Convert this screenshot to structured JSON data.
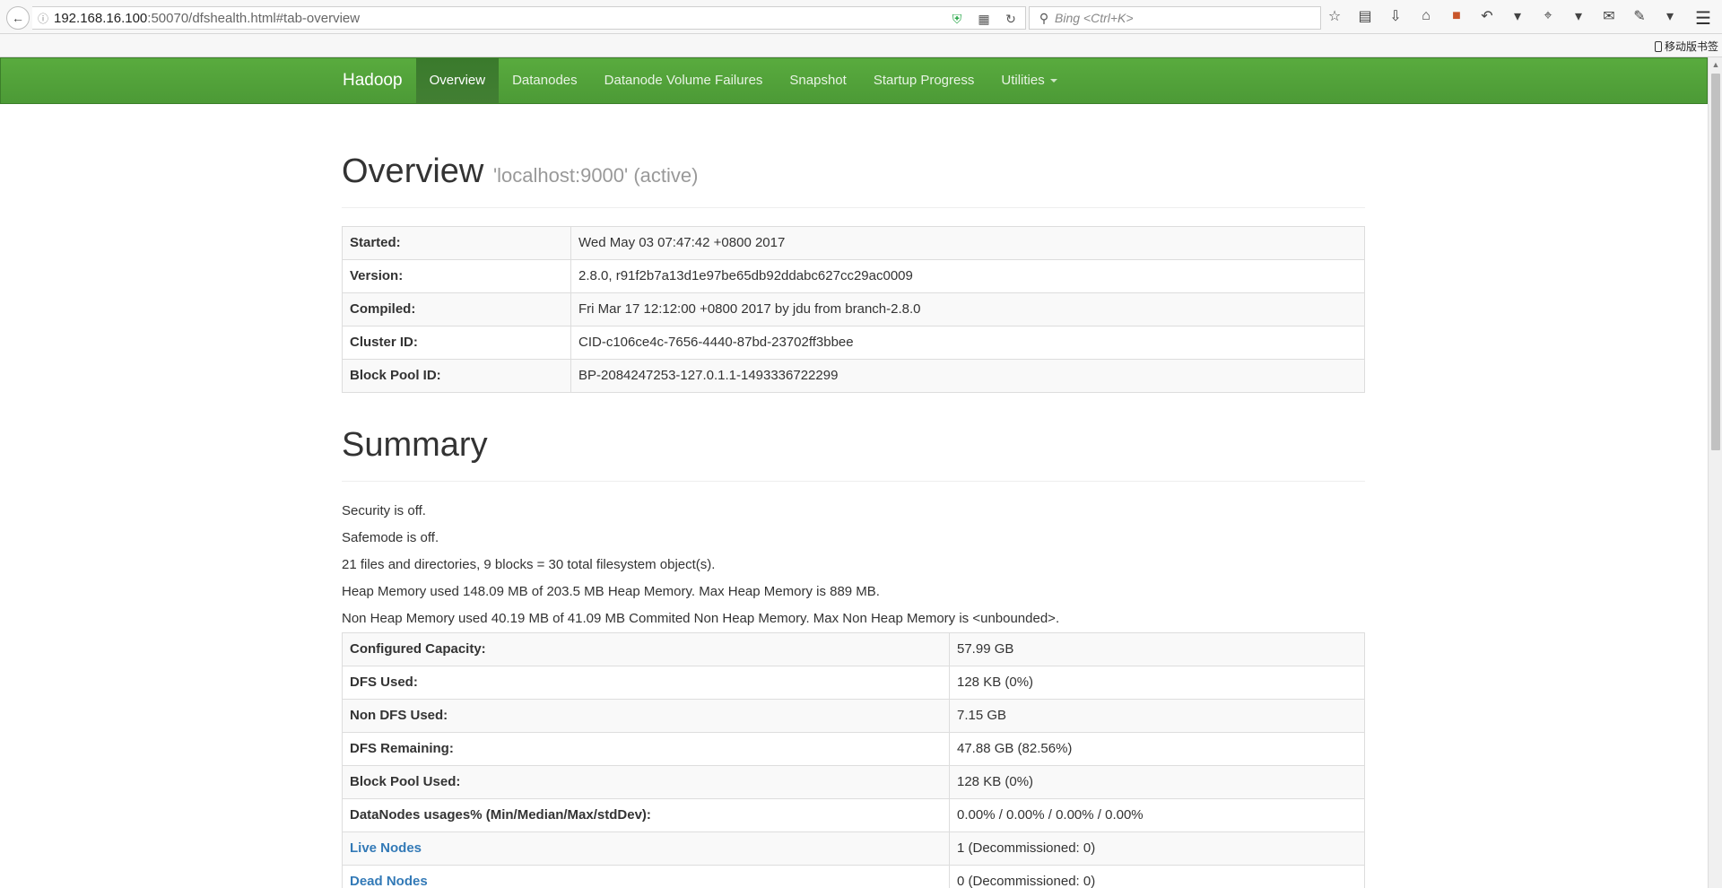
{
  "browser": {
    "url_host": "192.168.16.100",
    "url_rest": ":50070/dfshealth.html#tab-overview",
    "search_placeholder": "Bing <Ctrl+K>",
    "mobile_bookmarks": "移动版书签"
  },
  "navbar": {
    "brand": "Hadoop",
    "items": [
      {
        "label": "Overview",
        "active": true
      },
      {
        "label": "Datanodes"
      },
      {
        "label": "Datanode Volume Failures"
      },
      {
        "label": "Snapshot"
      },
      {
        "label": "Startup Progress"
      },
      {
        "label": "Utilities"
      }
    ]
  },
  "overview": {
    "title": "Overview",
    "subtitle": "'localhost:9000' (active)",
    "rows": [
      {
        "key": "Started:",
        "value": "Wed May 03 07:47:42 +0800 2017"
      },
      {
        "key": "Version:",
        "value": "2.8.0, r91f2b7a13d1e97be65db92ddabc627cc29ac0009"
      },
      {
        "key": "Compiled:",
        "value": "Fri Mar 17 12:12:00 +0800 2017 by jdu from branch-2.8.0"
      },
      {
        "key": "Cluster ID:",
        "value": "CID-c106ce4c-7656-4440-87bd-23702ff3bbee"
      },
      {
        "key": "Block Pool ID:",
        "value": "BP-2084247253-127.0.1.1-1493336722299"
      }
    ]
  },
  "summary": {
    "title": "Summary",
    "lines": [
      "Security is off.",
      "Safemode is off.",
      "21 files and directories, 9 blocks = 30 total filesystem object(s).",
      "Heap Memory used 148.09 MB of 203.5 MB Heap Memory. Max Heap Memory is 889 MB.",
      "Non Heap Memory used 40.19 MB of 41.09 MB Commited Non Heap Memory. Max Non Heap Memory is <unbounded>."
    ],
    "rows": [
      {
        "key": "Configured Capacity:",
        "value": "57.99 GB"
      },
      {
        "key": "DFS Used:",
        "value": "128 KB (0%)"
      },
      {
        "key": "Non DFS Used:",
        "value": "7.15 GB"
      },
      {
        "key": "DFS Remaining:",
        "value": "47.88 GB (82.56%)"
      },
      {
        "key": "Block Pool Used:",
        "value": "128 KB (0%)"
      },
      {
        "key": "DataNodes usages% (Min/Median/Max/stdDev):",
        "value": "0.00% / 0.00% / 0.00% / 0.00%"
      },
      {
        "key": "Live Nodes",
        "value": "1 (Decommissioned: 0)",
        "link": true
      },
      {
        "key": "Dead Nodes",
        "value": "0 (Decommissioned: 0)",
        "link": true
      }
    ]
  }
}
